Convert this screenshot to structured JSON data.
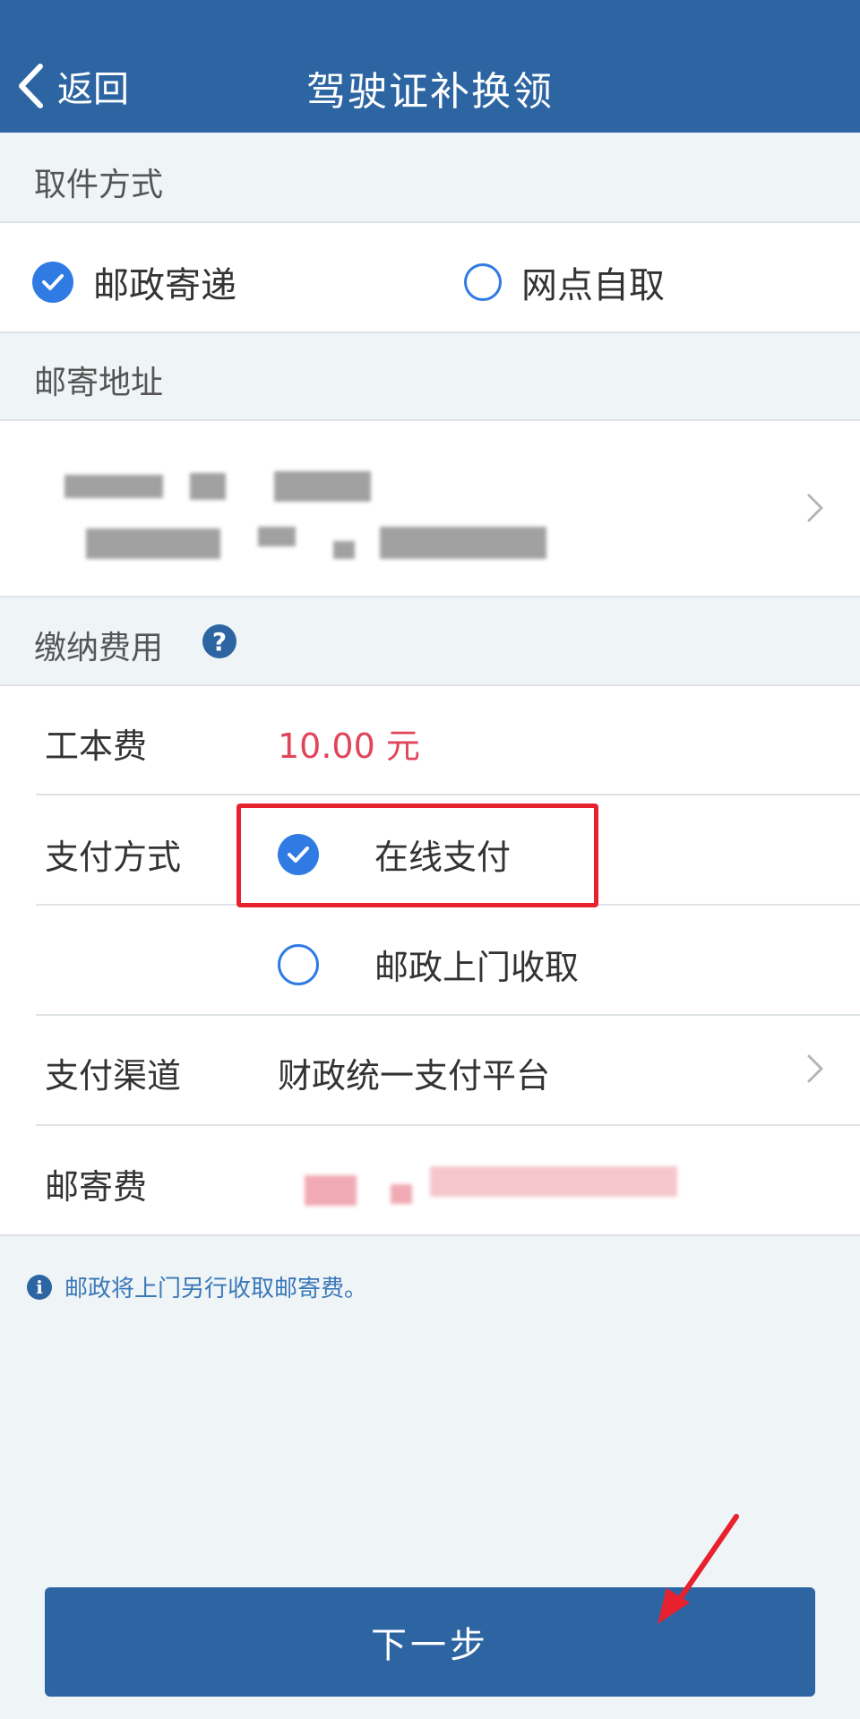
{
  "header": {
    "back_label": "返回",
    "title": "驾驶证补换领"
  },
  "pickup": {
    "section_title": "取件方式",
    "options": [
      {
        "label": "邮政寄递",
        "selected": true
      },
      {
        "label": "网点自取",
        "selected": false
      }
    ]
  },
  "address": {
    "section_title": "邮寄地址"
  },
  "fees": {
    "section_title": "缴纳费用",
    "rows": {
      "cost_label": "工本费",
      "cost_value": "10.00 元",
      "payment_method_label": "支付方式",
      "payment_options": [
        {
          "label": "在线支付",
          "selected": true
        },
        {
          "label": "邮政上门收取",
          "selected": false
        }
      ],
      "channel_label": "支付渠道",
      "channel_value": "财政统一支付平台",
      "postage_label": "邮寄费"
    }
  },
  "notice": "邮政将上门另行收取邮寄费。",
  "next_button": "下一步",
  "colors": {
    "primary": "#2d65a3",
    "accent": "#2f7be3",
    "price": "#e0455a",
    "highlight": "#e8212f"
  }
}
